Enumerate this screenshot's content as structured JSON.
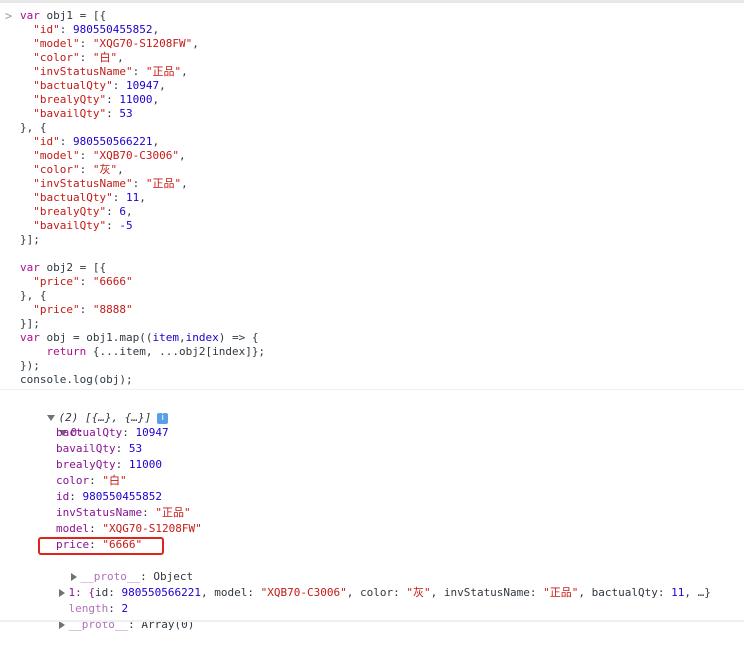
{
  "console_input": {
    "prompt_symbol": ">",
    "lines": [
      [
        [
          "kw",
          "var"
        ],
        [
          "ident",
          " obj1 = [{"
        ]
      ],
      [
        [
          "ident",
          "  "
        ],
        [
          "str",
          "\"id\""
        ],
        [
          "ident",
          ": "
        ],
        [
          "num",
          "980550455852"
        ],
        [
          "ident",
          ","
        ]
      ],
      [
        [
          "ident",
          "  "
        ],
        [
          "str",
          "\"model\""
        ],
        [
          "ident",
          ": "
        ],
        [
          "str",
          "\"XQG70-S1208FW\""
        ],
        [
          "ident",
          ","
        ]
      ],
      [
        [
          "ident",
          "  "
        ],
        [
          "str",
          "\"color\""
        ],
        [
          "ident",
          ": "
        ],
        [
          "str",
          "\"白\""
        ],
        [
          "ident",
          ","
        ]
      ],
      [
        [
          "ident",
          "  "
        ],
        [
          "str",
          "\"invStatusName\""
        ],
        [
          "ident",
          ": "
        ],
        [
          "str",
          "\"正品\""
        ],
        [
          "ident",
          ","
        ]
      ],
      [
        [
          "ident",
          "  "
        ],
        [
          "str",
          "\"bactualQty\""
        ],
        [
          "ident",
          ": "
        ],
        [
          "num",
          "10947"
        ],
        [
          "ident",
          ","
        ]
      ],
      [
        [
          "ident",
          "  "
        ],
        [
          "str",
          "\"brealyQty\""
        ],
        [
          "ident",
          ": "
        ],
        [
          "num",
          "11000"
        ],
        [
          "ident",
          ","
        ]
      ],
      [
        [
          "ident",
          "  "
        ],
        [
          "str",
          "\"bavailQty\""
        ],
        [
          "ident",
          ": "
        ],
        [
          "num",
          "53"
        ]
      ],
      [
        [
          "ident",
          "}, {"
        ]
      ],
      [
        [
          "ident",
          "  "
        ],
        [
          "str",
          "\"id\""
        ],
        [
          "ident",
          ": "
        ],
        [
          "num",
          "980550566221"
        ],
        [
          "ident",
          ","
        ]
      ],
      [
        [
          "ident",
          "  "
        ],
        [
          "str",
          "\"model\""
        ],
        [
          "ident",
          ": "
        ],
        [
          "str",
          "\"XQB70-C3006\""
        ],
        [
          "ident",
          ","
        ]
      ],
      [
        [
          "ident",
          "  "
        ],
        [
          "str",
          "\"color\""
        ],
        [
          "ident",
          ": "
        ],
        [
          "str",
          "\"灰\""
        ],
        [
          "ident",
          ","
        ]
      ],
      [
        [
          "ident",
          "  "
        ],
        [
          "str",
          "\"invStatusName\""
        ],
        [
          "ident",
          ": "
        ],
        [
          "str",
          "\"正品\""
        ],
        [
          "ident",
          ","
        ]
      ],
      [
        [
          "ident",
          "  "
        ],
        [
          "str",
          "\"bactualQty\""
        ],
        [
          "ident",
          ": "
        ],
        [
          "num",
          "11"
        ],
        [
          "ident",
          ","
        ]
      ],
      [
        [
          "ident",
          "  "
        ],
        [
          "str",
          "\"brealyQty\""
        ],
        [
          "ident",
          ": "
        ],
        [
          "num",
          "6"
        ],
        [
          "ident",
          ","
        ]
      ],
      [
        [
          "ident",
          "  "
        ],
        [
          "str",
          "\"bavailQty\""
        ],
        [
          "ident",
          ": "
        ],
        [
          "num",
          "-5"
        ]
      ],
      [
        [
          "ident",
          "}];"
        ]
      ],
      [
        [
          "ident",
          ""
        ]
      ],
      [
        [
          "kw",
          "var"
        ],
        [
          "ident",
          " obj2 = [{"
        ]
      ],
      [
        [
          "ident",
          "  "
        ],
        [
          "str",
          "\"price\""
        ],
        [
          "ident",
          ": "
        ],
        [
          "str",
          "\"6666\""
        ]
      ],
      [
        [
          "ident",
          "}, {"
        ]
      ],
      [
        [
          "ident",
          "  "
        ],
        [
          "str",
          "\"price\""
        ],
        [
          "ident",
          ": "
        ],
        [
          "str",
          "\"8888\""
        ]
      ],
      [
        [
          "ident",
          "}];"
        ]
      ],
      [
        [
          "kw",
          "var"
        ],
        [
          "ident",
          " obj = obj1.map(("
        ],
        [
          "num",
          "item"
        ],
        [
          "ident",
          ","
        ],
        [
          "num",
          "index"
        ],
        [
          "ident",
          ") => {"
        ]
      ],
      [
        [
          "ident",
          "    "
        ],
        [
          "kw",
          "return"
        ],
        [
          "ident",
          " {...item, ...obj2[index]};"
        ]
      ],
      [
        [
          "ident",
          "});"
        ]
      ],
      [
        [
          "ident",
          "console.log(obj);"
        ]
      ]
    ]
  },
  "console_output": {
    "summary": "(2) [{…}, {…}]",
    "info_icon_label": "i",
    "item0_label": "0:",
    "item0_props": [
      {
        "key": "bactualQty",
        "value": "10947",
        "type": "num"
      },
      {
        "key": "bavailQty",
        "value": "53",
        "type": "num"
      },
      {
        "key": "brealyQty",
        "value": "11000",
        "type": "num"
      },
      {
        "key": "color",
        "value": "\"白\"",
        "type": "str"
      },
      {
        "key": "id",
        "value": "980550455852",
        "type": "num"
      },
      {
        "key": "invStatusName",
        "value": "\"正品\"",
        "type": "str"
      },
      {
        "key": "model",
        "value": "\"XQG70-S1208FW\"",
        "type": "str"
      },
      {
        "key": "price",
        "value": "\"6666\"",
        "type": "str"
      }
    ],
    "item0_proto_key": "__proto__",
    "item0_proto_value": "Object",
    "item1_prefix": "1: {",
    "item1_parts": [
      {
        "key": "id",
        "value": "980550566221",
        "type": "num",
        "sep": ", "
      },
      {
        "key": "model",
        "value": "\"XQB70-C3006\"",
        "type": "str",
        "sep": ", "
      },
      {
        "key": "color",
        "value": "\"灰\"",
        "type": "str",
        "sep": ", "
      },
      {
        "key": "invStatusName",
        "value": "\"正品\"",
        "type": "str",
        "sep": ", "
      },
      {
        "key": "bactualQty",
        "value": "11",
        "type": "num",
        "sep": ", …}"
      }
    ],
    "length_key": "length",
    "length_value": "2",
    "array_proto_key": "__proto__",
    "array_proto_value": "Array(0)"
  },
  "highlight_color": "#e0241b"
}
